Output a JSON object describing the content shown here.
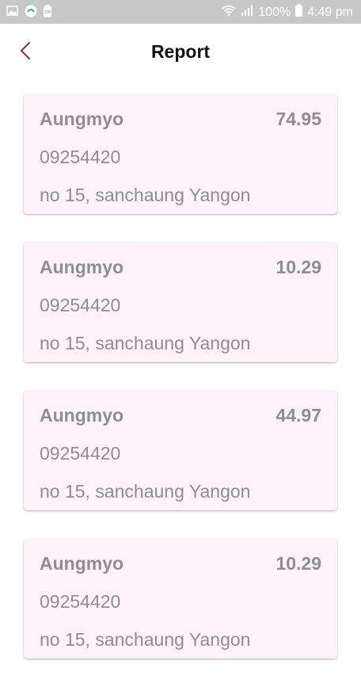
{
  "status_bar": {
    "battery": "100%",
    "time": "4:49 pm",
    "left_icons": [
      "gallery-icon",
      "app-icon",
      "battery-saver-icon"
    ],
    "right_icons": [
      "wifi-icon",
      "signal-icon",
      "battery-icon"
    ]
  },
  "header": {
    "title": "Report",
    "back_icon": "chevron-left-icon",
    "accent": "#7d3b5b"
  },
  "cards": [
    {
      "name": "Aungmyo",
      "amount": "74.95",
      "phone": "09254420",
      "address": "no 15, sanchaung Yangon"
    },
    {
      "name": "Aungmyo",
      "amount": "10.29",
      "phone": "09254420",
      "address": "no 15, sanchaung Yangon"
    },
    {
      "name": "Aungmyo",
      "amount": "44.97",
      "phone": "09254420",
      "address": "no 15, sanchaung Yangon"
    },
    {
      "name": "Aungmyo",
      "amount": "10.29",
      "phone": "09254420",
      "address": "no 15, sanchaung Yangon"
    }
  ],
  "colors": {
    "status_bar_bg": "#c8c8c8",
    "card_bg": "#fdf2f8",
    "card_text": "#8e8e8e",
    "title_text": "#111111"
  }
}
